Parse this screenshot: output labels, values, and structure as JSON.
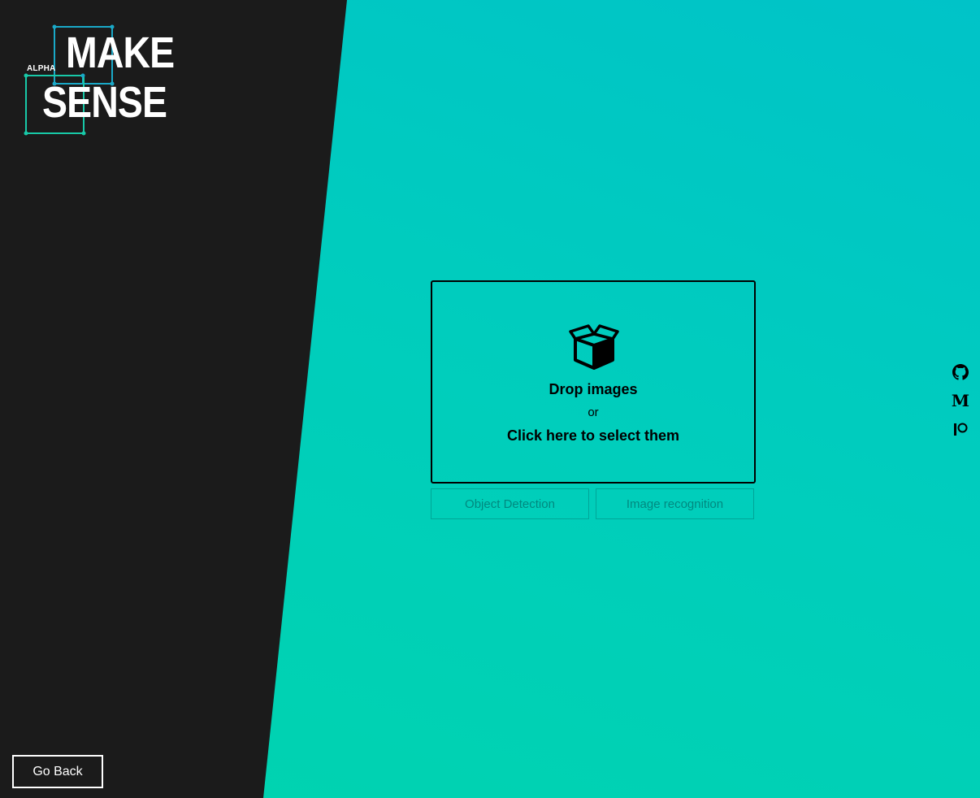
{
  "logo": {
    "alpha": "ALPHA",
    "line1": "MAKE",
    "line2": "SENSE"
  },
  "dropzone": {
    "icon": "box-open-icon",
    "title": "Drop images",
    "or": "or",
    "select": "Click here to select them"
  },
  "modes": [
    {
      "label": "Object Detection",
      "enabled": false
    },
    {
      "label": "Image recognition",
      "enabled": false
    }
  ],
  "social": [
    {
      "name": "github-icon"
    },
    {
      "name": "medium-icon",
      "glyph": "M"
    },
    {
      "name": "patreon-icon"
    }
  ],
  "footer": {
    "go_back": "Go Back"
  },
  "colors": {
    "dark_panel": "#1b1b1b",
    "gradient_top": "#00c3c8",
    "gradient_bottom": "#00d4ae",
    "logo_accent_cyan": "#1aa9c8",
    "logo_accent_teal": "#18c9a8"
  }
}
